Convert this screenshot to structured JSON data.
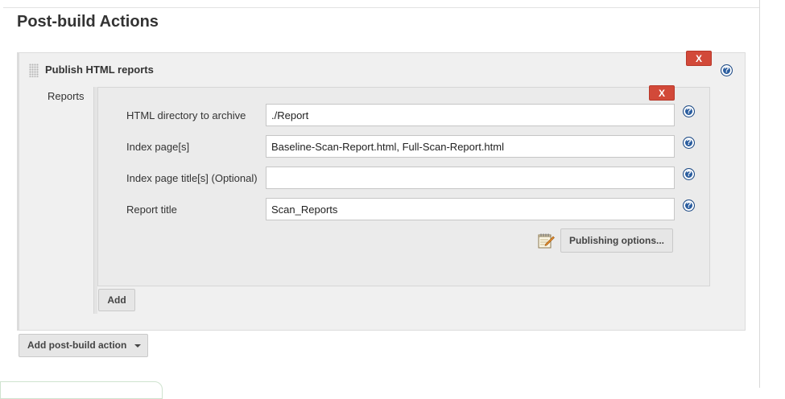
{
  "section": {
    "title": "Post-build Actions"
  },
  "publisher": {
    "title": "Publish HTML reports",
    "delete_label": "X",
    "help_glyph": "?",
    "reports_label": "Reports",
    "report": {
      "delete_label": "X",
      "fields": [
        {
          "label": "HTML directory to archive",
          "value": "./Report",
          "help_glyph": "?"
        },
        {
          "label": "Index page[s]",
          "value": "Baseline-Scan-Report.html, Full-Scan-Report.html",
          "help_glyph": "?"
        },
        {
          "label": "Index page title[s] (Optional)",
          "value": "",
          "help_glyph": "?"
        },
        {
          "label": "Report title",
          "value": "Scan_Reports",
          "help_glyph": "?"
        }
      ],
      "publishing_options_label": "Publishing options...",
      "publishing_icon": "notepad-icon"
    },
    "add_label": "Add"
  },
  "footer": {
    "add_action_label": "Add post-build action"
  },
  "colors": {
    "delete_red": "#d24939",
    "help_blue": "#2a5d9f",
    "panel_bg": "#f0f0f0",
    "inner_bg": "#ebebeb"
  }
}
